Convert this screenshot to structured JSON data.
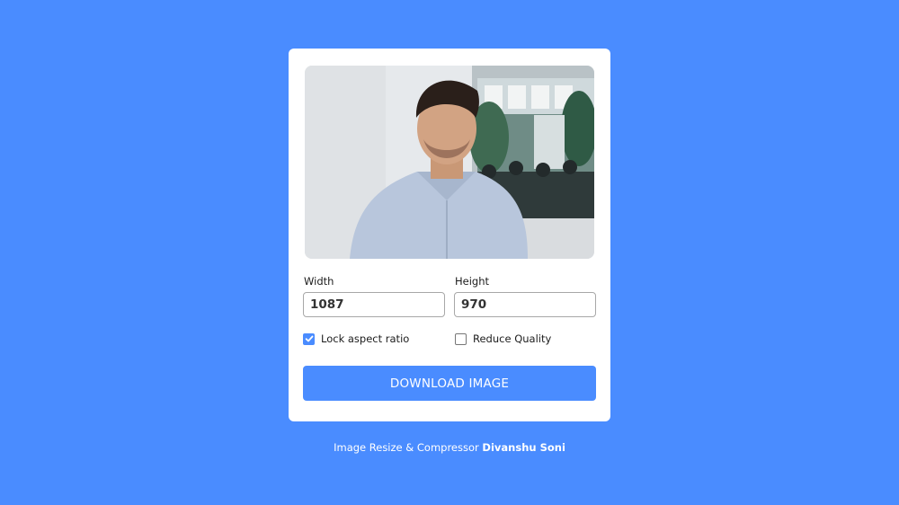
{
  "preview": {
    "icon": "photo-preview"
  },
  "width_field": {
    "label": "Width",
    "value": "1087"
  },
  "height_field": {
    "label": "Height",
    "value": "970"
  },
  "options": {
    "lock_aspect": {
      "label": "Lock aspect ratio",
      "checked": true
    },
    "reduce_quality": {
      "label": "Reduce Quality",
      "checked": false
    }
  },
  "download_button": {
    "label": "DOWNLOAD IMAGE"
  },
  "footer": {
    "prefix": "Image Resize & Compressor",
    "author": "Divanshu Soni"
  },
  "colors": {
    "background": "#4a8cff",
    "accent": "#4a8cff",
    "card": "#ffffff"
  }
}
